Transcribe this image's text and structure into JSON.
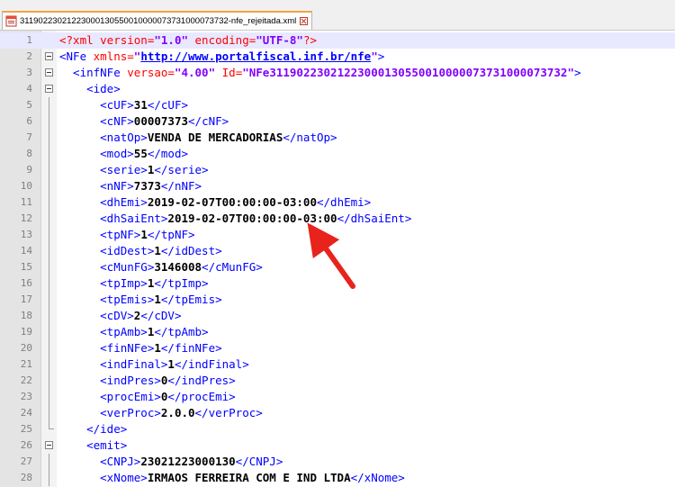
{
  "tab": {
    "title": "31190223021223000130550010000073731000073732-nfe_rejeitada.xml"
  },
  "lines": [
    [
      [
        "pi",
        "<?xml "
      ],
      [
        "attr",
        "version="
      ],
      [
        "val",
        "\"1.0\" "
      ],
      [
        "attr",
        "encoding="
      ],
      [
        "val",
        "\"UTF-8\""
      ],
      [
        "pi",
        "?>"
      ]
    ],
    [
      [
        "tag",
        "<NFe "
      ],
      [
        "attr",
        "xmlns="
      ],
      [
        "val",
        "\""
      ],
      [
        "url",
        "http://www.portalfiscal.inf.br/nfe"
      ],
      [
        "val",
        "\""
      ],
      [
        "tag",
        ">"
      ]
    ],
    [
      [
        "tag",
        "  <infNFe "
      ],
      [
        "attr",
        "versao="
      ],
      [
        "val",
        "\"4.00\" "
      ],
      [
        "attr",
        "Id="
      ],
      [
        "val",
        "\"NFe31190223021223000130550010000073731000073732\""
      ],
      [
        "tag",
        ">"
      ]
    ],
    [
      [
        "tag",
        "    <ide>"
      ]
    ],
    [
      [
        "tag",
        "      <cUF>"
      ],
      [
        "txt",
        "31"
      ],
      [
        "tag",
        "</cUF>"
      ]
    ],
    [
      [
        "tag",
        "      <cNF>"
      ],
      [
        "txt",
        "00007373"
      ],
      [
        "tag",
        "</cNF>"
      ]
    ],
    [
      [
        "tag",
        "      <natOp>"
      ],
      [
        "txt",
        "VENDA DE MERCADORIAS"
      ],
      [
        "tag",
        "</natOp>"
      ]
    ],
    [
      [
        "tag",
        "      <mod>"
      ],
      [
        "txt",
        "55"
      ],
      [
        "tag",
        "</mod>"
      ]
    ],
    [
      [
        "tag",
        "      <serie>"
      ],
      [
        "txt",
        "1"
      ],
      [
        "tag",
        "</serie>"
      ]
    ],
    [
      [
        "tag",
        "      <nNF>"
      ],
      [
        "txt",
        "7373"
      ],
      [
        "tag",
        "</nNF>"
      ]
    ],
    [
      [
        "tag",
        "      <dhEmi>"
      ],
      [
        "txt",
        "2019-02-07T00:00:00-03:00"
      ],
      [
        "tag",
        "</dhEmi>"
      ]
    ],
    [
      [
        "tag",
        "      <dhSaiEnt>"
      ],
      [
        "txt",
        "2019-02-07T00:00:00-03:00"
      ],
      [
        "tag",
        "</dhSaiEnt>"
      ]
    ],
    [
      [
        "tag",
        "      <tpNF>"
      ],
      [
        "txt",
        "1"
      ],
      [
        "tag",
        "</tpNF>"
      ]
    ],
    [
      [
        "tag",
        "      <idDest>"
      ],
      [
        "txt",
        "1"
      ],
      [
        "tag",
        "</idDest>"
      ]
    ],
    [
      [
        "tag",
        "      <cMunFG>"
      ],
      [
        "txt",
        "3146008"
      ],
      [
        "tag",
        "</cMunFG>"
      ]
    ],
    [
      [
        "tag",
        "      <tpImp>"
      ],
      [
        "txt",
        "1"
      ],
      [
        "tag",
        "</tpImp>"
      ]
    ],
    [
      [
        "tag",
        "      <tpEmis>"
      ],
      [
        "txt",
        "1"
      ],
      [
        "tag",
        "</tpEmis>"
      ]
    ],
    [
      [
        "tag",
        "      <cDV>"
      ],
      [
        "txt",
        "2"
      ],
      [
        "tag",
        "</cDV>"
      ]
    ],
    [
      [
        "tag",
        "      <tpAmb>"
      ],
      [
        "txt",
        "1"
      ],
      [
        "tag",
        "</tpAmb>"
      ]
    ],
    [
      [
        "tag",
        "      <finNFe>"
      ],
      [
        "txt",
        "1"
      ],
      [
        "tag",
        "</finNFe>"
      ]
    ],
    [
      [
        "tag",
        "      <indFinal>"
      ],
      [
        "txt",
        "1"
      ],
      [
        "tag",
        "</indFinal>"
      ]
    ],
    [
      [
        "tag",
        "      <indPres>"
      ],
      [
        "txt",
        "0"
      ],
      [
        "tag",
        "</indPres>"
      ]
    ],
    [
      [
        "tag",
        "      <procEmi>"
      ],
      [
        "txt",
        "0"
      ],
      [
        "tag",
        "</procEmi>"
      ]
    ],
    [
      [
        "tag",
        "      <verProc>"
      ],
      [
        "txt",
        "2.0.0"
      ],
      [
        "tag",
        "</verProc>"
      ]
    ],
    [
      [
        "tag",
        "    </ide>"
      ]
    ],
    [
      [
        "tag",
        "    <emit>"
      ]
    ],
    [
      [
        "tag",
        "      <CNPJ>"
      ],
      [
        "txt",
        "23021223000130"
      ],
      [
        "tag",
        "</CNPJ>"
      ]
    ],
    [
      [
        "tag",
        "      <xNome>"
      ],
      [
        "txt",
        "IRMAOS FERREIRA COM E IND LTDA"
      ],
      [
        "tag",
        "</xNome>"
      ]
    ]
  ],
  "line_numbers": [
    "1",
    "2",
    "3",
    "4",
    "5",
    "6",
    "7",
    "8",
    "9",
    "10",
    "11",
    "12",
    "13",
    "14",
    "15",
    "16",
    "17",
    "18",
    "19",
    "20",
    "21",
    "22",
    "23",
    "24",
    "25",
    "26",
    "27",
    "28"
  ],
  "fold_markers": {
    "2": "box",
    "3": "box",
    "4": "box",
    "25": "end",
    "26": "box"
  },
  "current_line": 1,
  "colors": {
    "tag": "#0000ff",
    "attr": "#ff0000",
    "value": "#8000ff",
    "arrow": "#e8231c",
    "tab_accent": "#f5a142"
  }
}
